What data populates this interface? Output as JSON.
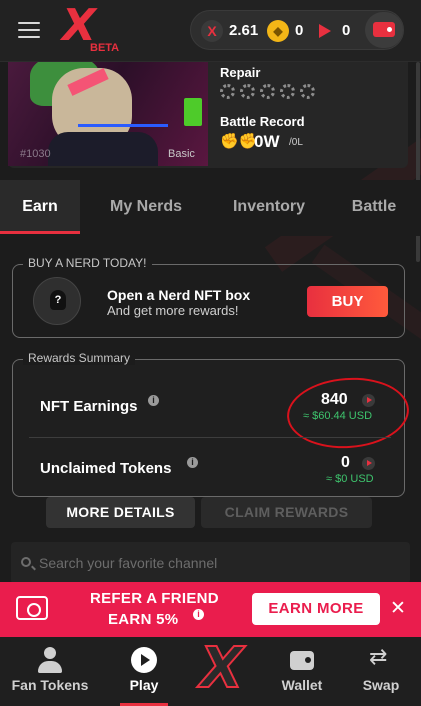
{
  "header": {
    "logo_text": "X",
    "logo_badge": "BETA",
    "balances": {
      "x_token": "2.61",
      "coin": "0",
      "play_token": "0"
    },
    "icons": {
      "menu": "hamburger-icon",
      "x_token": "x-token-icon",
      "coin": "coin-icon",
      "play_token": "play-token-icon",
      "wallet": "wallet-icon"
    },
    "accent": "#e8303f"
  },
  "nerd_card": {
    "id_text": "#1030",
    "rarity": "Basic",
    "repair_label": "Repair",
    "battle_record_label": "Battle Record",
    "battle_record_value": "0W",
    "battle_record_sub": "/0L"
  },
  "tabs": [
    {
      "label": "Earn",
      "active": true
    },
    {
      "label": "My Nerds",
      "active": false
    },
    {
      "label": "Inventory",
      "active": false
    },
    {
      "label": "Battle",
      "active": false
    }
  ],
  "buy_box": {
    "legend": "BUY A NERD TODAY!",
    "avatar_glyph": "?",
    "title": "Open a Nerd NFT box",
    "subtitle": "And get more rewards!",
    "button": "BUY"
  },
  "rewards": {
    "legend": "Rewards Summary",
    "info_glyph": "i",
    "nft_earnings_label": "NFT Earnings",
    "nft_earnings_amount": "840",
    "nft_earnings_usd": "≈ $60.44 USD",
    "unclaimed_label": "Unclaimed Tokens",
    "unclaimed_amount": "0",
    "unclaimed_usd": "≈ $0 USD",
    "usd_color": "#3ec46d"
  },
  "actions": {
    "more_details": "MORE DETAILS",
    "claim_rewards": "CLAIM REWARDS"
  },
  "search": {
    "placeholder": "Search your favorite channel"
  },
  "refer": {
    "line1": "REFER A FRIEND",
    "line2": "EARN 5%",
    "info_glyph": "i",
    "button": "EARN MORE",
    "close": "✕",
    "background": "#ea1d4d"
  },
  "bottom_nav": [
    {
      "label": "Fan Tokens",
      "icon": "person-icon"
    },
    {
      "label": "Play",
      "icon": "play-icon",
      "active": true
    },
    {
      "label": "",
      "icon": "x-logo-icon"
    },
    {
      "label": "Wallet",
      "icon": "wallet-icon"
    },
    {
      "label": "Swap",
      "icon": "swap-icon"
    }
  ]
}
